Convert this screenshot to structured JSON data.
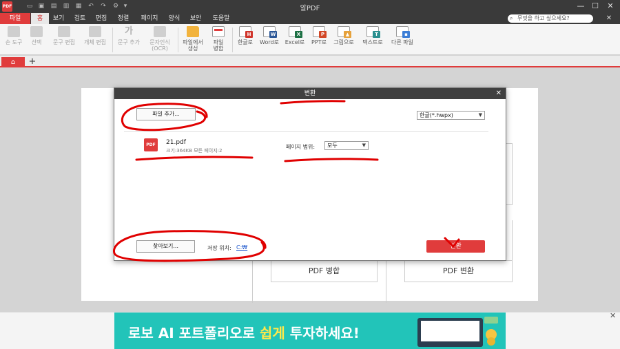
{
  "app": {
    "logo_text": "PDF",
    "window_title": "알PDF",
    "window_buttons": [
      "—",
      "☐",
      "✕"
    ]
  },
  "menu": {
    "items": [
      "파일",
      "홈",
      "보기",
      "검토",
      "편집",
      "정렬",
      "페이지",
      "양식",
      "보안",
      "도움말"
    ],
    "active": "홈",
    "search_placeholder": "무엇을 하고 싶으세요?",
    "close": "✕"
  },
  "ribbon": {
    "hand": "손 도구",
    "select": "선택",
    "text_edit": "문구 편집",
    "object_edit": "개체 편집",
    "add_text": "문구 추가",
    "ocr_line1": "문자인식",
    "ocr_line2": "(OCR)",
    "create_line1": "파일에서",
    "create_line2": "생성",
    "merge_line1": "파일",
    "merge_line2": "병합",
    "to_hwp": "한글로",
    "to_word": "Word로",
    "to_excel": "Excel로",
    "to_ppt": "PPT로",
    "to_image": "그림으로",
    "to_text": "텍스트로",
    "other_file": "다른 파일",
    "add_text_icon_char": "가"
  },
  "tabs": {
    "home_icon": "home-icon",
    "plus": "+"
  },
  "background_cards": {
    "merge_label": "PDF 병합",
    "convert_label": "PDF 변환"
  },
  "dialog": {
    "title": "변환",
    "close": "✕",
    "add_file_button": "파일 추가...",
    "format_select": "한글(*.hwpx)",
    "file": {
      "icon_text": "PDF",
      "name": "21.pdf",
      "meta": "크기:364KB   모든 페이지:2"
    },
    "page_range_label": "페이지 범위:",
    "page_range_value": "모두",
    "browse_button": "찾아보기...",
    "save_location_label": "저장 위치:",
    "save_location_value": "C:₩",
    "convert_button": "변환"
  },
  "ad": {
    "text_before": "로보 AI 포트폴리오로 ",
    "text_highlight": "쉽게",
    "text_after": " 투자하세요!",
    "close": "✕"
  },
  "colors": {
    "accent": "#e03c3c",
    "titlebar": "#3a3a3a",
    "ad_background": "#22c4b9",
    "annotation": "#e00000"
  }
}
